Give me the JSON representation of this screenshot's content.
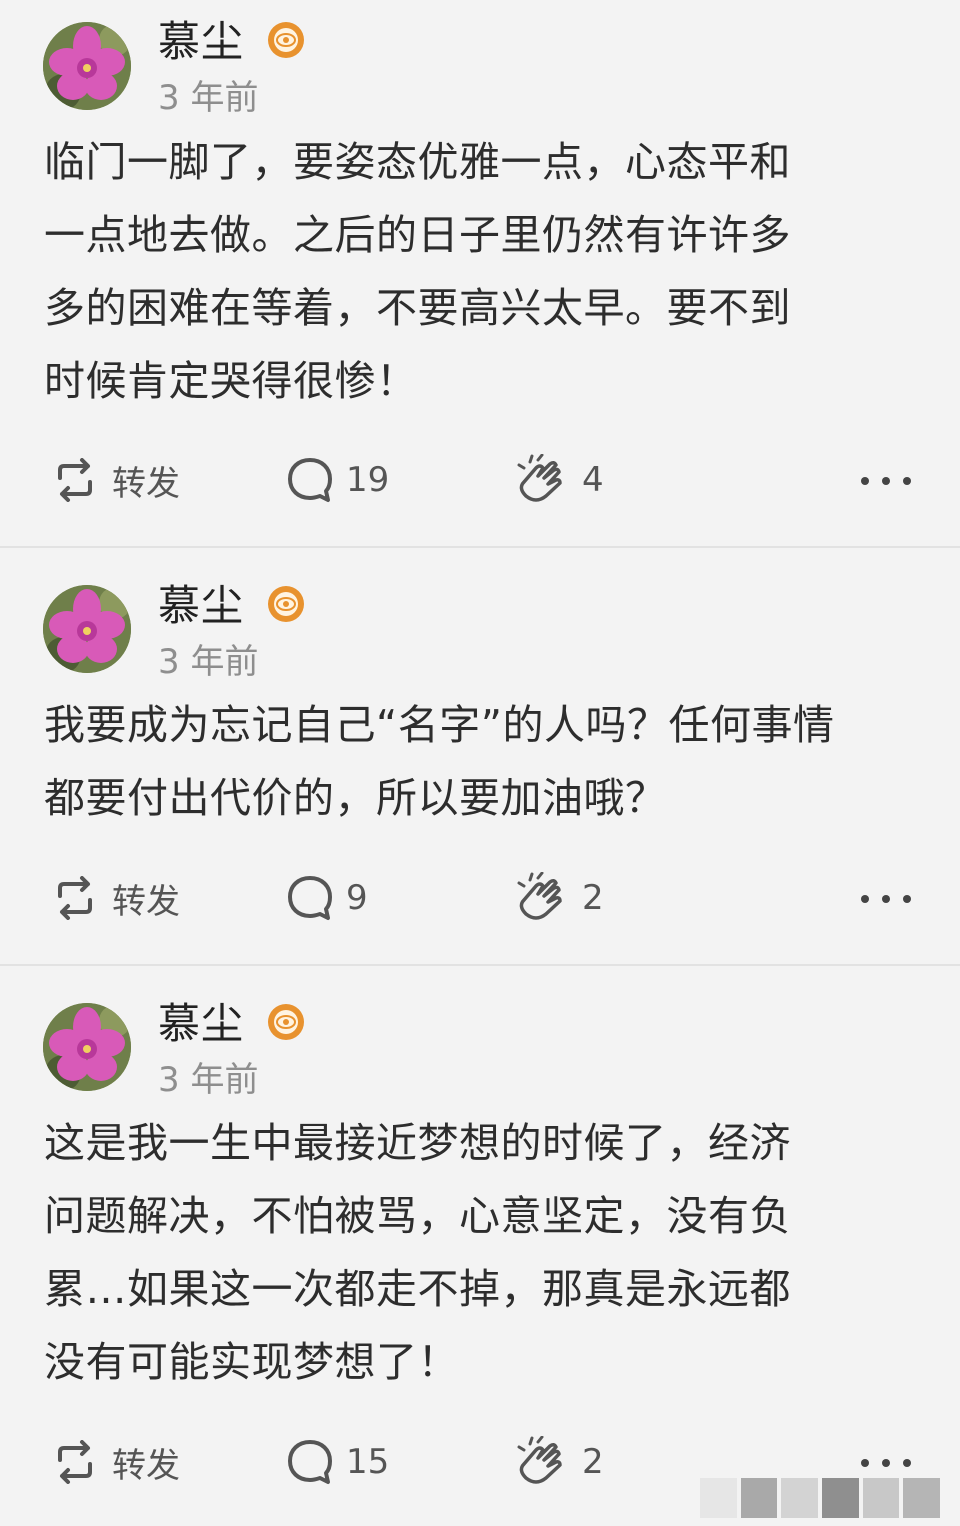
{
  "posts": [
    {
      "author": "慕尘",
      "time": "3 年前",
      "text": "临门一脚了，要姿态优雅一点，心态平和\n一点地去做。之后的日子里仍然有许许多\n多的困难在等着，不要高兴太早。要不到\n时候肯定哭得很惨！",
      "repost_label": "转发",
      "comments": "19",
      "likes": "4"
    },
    {
      "author": "慕尘",
      "time": "3 年前",
      "text": "我要成为忘记自己“名字”的人吗？任何事情\n都要付出代价的，所以要加油哦？",
      "repost_label": "转发",
      "comments": "9",
      "likes": "2"
    },
    {
      "author": "慕尘",
      "time": "3 年前",
      "text": "这是我一生中最接近梦想的时候了，经济\n问题解决，不怕被骂，心意坚定，没有负\n累…如果这一次都走不掉，那真是永远都\n没有可能实现梦想了！",
      "repost_label": "转发",
      "comments": "15",
      "likes": "2"
    }
  ],
  "icons": {
    "avatar": "pink-flower-avatar",
    "badge": "orange-eye-badge",
    "repost": "repost-icon",
    "comment": "comment-icon",
    "like": "clap-icon",
    "more": "more-icon"
  },
  "colors": {
    "background": "#f3f3f3",
    "badge": "#e8922e",
    "avatar_flower": "#d850b8",
    "text": "#2d2d2d",
    "time": "#8e8e8e"
  }
}
